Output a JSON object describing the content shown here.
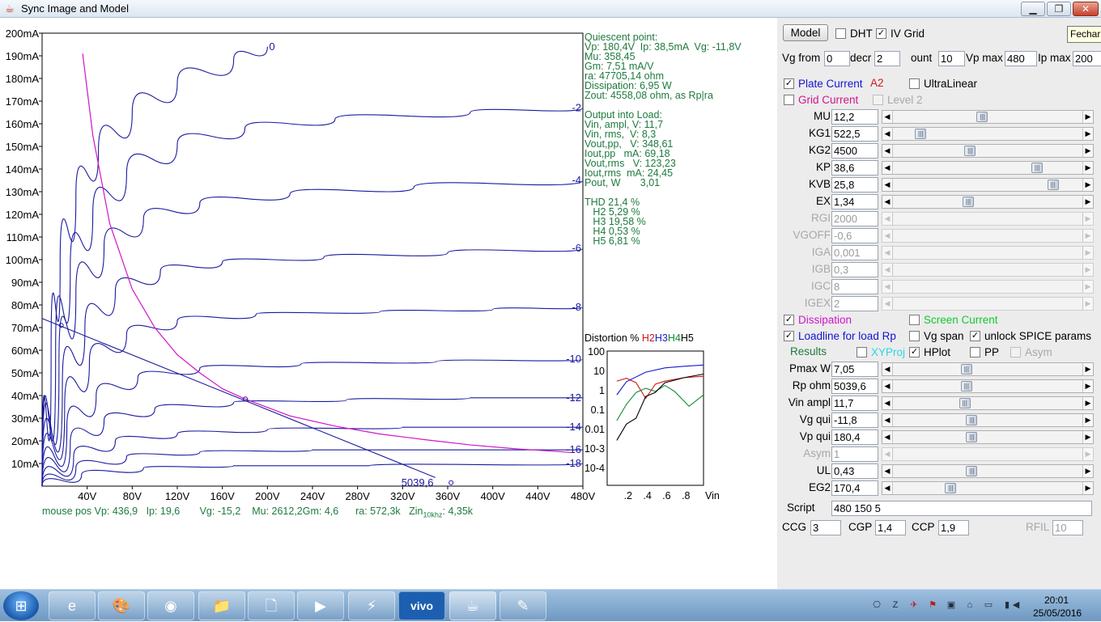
{
  "window": {
    "title": "Sync Image and Model",
    "min": "▁",
    "max": "❐",
    "close": "✕"
  },
  "chart_data": {
    "type": "line",
    "x": {
      "label": "Vp",
      "unit": "V",
      "min": 0,
      "max": 480,
      "ticks": [
        "40V",
        "80V",
        "120V",
        "160V",
        "200V",
        "240V",
        "280V",
        "320V",
        "360V",
        "400V",
        "440V",
        "480V"
      ]
    },
    "y": {
      "label": "Ip",
      "unit": "mA",
      "min": 0,
      "max": 200,
      "ticks": [
        "10mA",
        "20mA",
        "30mA",
        "40mA",
        "50mA",
        "60mA",
        "70mA",
        "80mA",
        "90mA",
        "100mA",
        "110mA",
        "120mA",
        "130mA",
        "140mA",
        "150mA",
        "160mA",
        "170mA",
        "180mA",
        "190mA",
        "200mA"
      ]
    },
    "grid": false,
    "curve_labels": [
      "0",
      "-2",
      "-4",
      "-6",
      "-8",
      "-10",
      "-12",
      "-14",
      "-16",
      "-18"
    ],
    "series": [
      {
        "vg": 0,
        "values": [
          [
            0,
            0
          ],
          [
            8,
            60
          ],
          [
            16,
            98
          ],
          [
            30,
            128
          ],
          [
            50,
            148
          ],
          [
            80,
            165
          ],
          [
            120,
            178
          ],
          [
            170,
            188
          ],
          [
            200,
            194
          ]
        ]
      },
      {
        "vg": -2,
        "values": [
          [
            0,
            0
          ],
          [
            12,
            60
          ],
          [
            25,
            96
          ],
          [
            45,
            120
          ],
          [
            75,
            138
          ],
          [
            120,
            151
          ],
          [
            180,
            158
          ],
          [
            260,
            162
          ],
          [
            380,
            165
          ],
          [
            480,
            167
          ]
        ]
      },
      {
        "vg": -4,
        "values": [
          [
            0,
            0
          ],
          [
            15,
            55
          ],
          [
            30,
            85
          ],
          [
            55,
            106
          ],
          [
            90,
            118
          ],
          [
            140,
            125
          ],
          [
            220,
            129
          ],
          [
            330,
            132
          ],
          [
            480,
            135
          ]
        ]
      },
      {
        "vg": -6,
        "values": [
          [
            0,
            0
          ],
          [
            18,
            45
          ],
          [
            38,
            70
          ],
          [
            65,
            86
          ],
          [
            105,
            95
          ],
          [
            160,
            99
          ],
          [
            250,
            101
          ],
          [
            360,
            103
          ],
          [
            480,
            105
          ]
        ]
      },
      {
        "vg": -8,
        "values": [
          [
            0,
            0
          ],
          [
            20,
            35
          ],
          [
            42,
            55
          ],
          [
            75,
            67
          ],
          [
            120,
            73
          ],
          [
            190,
            76
          ],
          [
            300,
            77
          ],
          [
            400,
            78
          ],
          [
            480,
            79
          ]
        ]
      },
      {
        "vg": -10,
        "values": [
          [
            0,
            0
          ],
          [
            22,
            26
          ],
          [
            48,
            40
          ],
          [
            85,
            48
          ],
          [
            140,
            52
          ],
          [
            230,
            54
          ],
          [
            350,
            55
          ],
          [
            480,
            56
          ]
        ]
      },
      {
        "vg": -12,
        "values": [
          [
            0,
            0
          ],
          [
            25,
            19
          ],
          [
            55,
            29
          ],
          [
            100,
            34
          ],
          [
            170,
            37
          ],
          [
            270,
            38
          ],
          [
            380,
            39
          ],
          [
            480,
            39
          ]
        ]
      },
      {
        "vg": -14,
        "values": [
          [
            0,
            0
          ],
          [
            28,
            13
          ],
          [
            65,
            20
          ],
          [
            120,
            23
          ],
          [
            200,
            25
          ],
          [
            320,
            26
          ],
          [
            480,
            26
          ]
        ]
      },
      {
        "vg": -16,
        "values": [
          [
            0,
            0
          ],
          [
            30,
            8
          ],
          [
            75,
            13
          ],
          [
            140,
            15
          ],
          [
            240,
            16
          ],
          [
            360,
            16
          ],
          [
            480,
            16
          ]
        ]
      },
      {
        "vg": -18,
        "values": [
          [
            0,
            0
          ],
          [
            35,
            5
          ],
          [
            90,
            8
          ],
          [
            170,
            9
          ],
          [
            290,
            9
          ],
          [
            480,
            10
          ]
        ]
      }
    ],
    "dissipation": [
      [
        36,
        191
      ],
      [
        45,
        155
      ],
      [
        60,
        116
      ],
      [
        80,
        87
      ],
      [
        100,
        70
      ],
      [
        120,
        58
      ],
      [
        140,
        50
      ],
      [
        160,
        43
      ],
      [
        180,
        38.5
      ],
      [
        220,
        31
      ],
      [
        260,
        26.5
      ],
      [
        300,
        23
      ],
      [
        340,
        20.5
      ],
      [
        380,
        18.2
      ],
      [
        420,
        16.5
      ],
      [
        460,
        15.2
      ],
      [
        470,
        14.8
      ]
    ],
    "loadline": [
      [
        0,
        74
      ],
      [
        349,
        3.8
      ]
    ],
    "q_point": [
      180.4,
      38.5
    ],
    "marker_low": [
      17,
      71
    ],
    "load_point_label": "5039,6",
    "load_point_marker": [
      363,
      1.5
    ]
  },
  "distortion_chart": {
    "y_ticks": [
      "100",
      "10",
      "1",
      "0.1",
      "0.01",
      "10-3",
      "10-4"
    ],
    "x_ticks": [
      ".2",
      ".4",
      ".6",
      ".8",
      "Vin"
    ],
    "series": [
      {
        "name": "H2",
        "color": "#d01818",
        "values": [
          [
            0.1,
            3.0
          ],
          [
            0.2,
            4.2
          ],
          [
            0.3,
            2.5
          ],
          [
            0.4,
            0.4
          ],
          [
            0.5,
            2.1
          ],
          [
            0.6,
            3.0
          ],
          [
            0.8,
            4.5
          ],
          [
            1.0,
            5.3
          ]
        ]
      },
      {
        "name": "H3",
        "color": "#1818d0",
        "values": [
          [
            0.1,
            0.6
          ],
          [
            0.2,
            2.8
          ],
          [
            0.4,
            8.5
          ],
          [
            0.6,
            14
          ],
          [
            0.8,
            17
          ],
          [
            1.0,
            19.6
          ]
        ]
      },
      {
        "name": "H4",
        "color": "#118a32",
        "values": [
          [
            0.1,
            0.03
          ],
          [
            0.2,
            0.2
          ],
          [
            0.3,
            0.8
          ],
          [
            0.4,
            1.3
          ],
          [
            0.5,
            0.9
          ],
          [
            0.6,
            1.8
          ],
          [
            0.7,
            0.9
          ],
          [
            0.85,
            0.16
          ],
          [
            1.0,
            0.6
          ]
        ]
      },
      {
        "name": "H5",
        "color": "#000000",
        "values": [
          [
            0.1,
            0.003
          ],
          [
            0.2,
            0.02
          ],
          [
            0.3,
            0.04
          ],
          [
            0.4,
            0.5
          ],
          [
            0.5,
            0.8
          ],
          [
            0.6,
            2.5
          ],
          [
            0.8,
            4.5
          ],
          [
            1.0,
            6.8
          ]
        ]
      }
    ]
  },
  "results": [
    "Quiescent point:",
    "Vp: 180,4V  Ip: 38,5mA  Vg: -11,8V",
    "Mu: 358,45",
    "Gm: 7,51 mA/V",
    "ra: 47705,14 ohm",
    "Dissipation: 6,95 W",
    "Zout: 4558,08 ohm, as Rp|ra",
    "",
    "Output into Load:",
    "Vin, ampl, V: 11,7",
    "Vin, rms,  V: 8,3",
    "Vout,pp,   V: 348,61",
    "Iout,pp   mA: 69,18",
    "Vout,rms   V: 123,23",
    "Iout,rms  mA: 24,45",
    "Pout, W       3,01",
    "",
    "THD 21,4 %",
    "   H2 5,29 %",
    "   H3 19,58 %",
    "   H4 0,53 %",
    "   H5 6,81 %"
  ],
  "distortion": {
    "prefix": "Distortion % ",
    "h2": "H2",
    "h3": "H3",
    "h4": "H4",
    "h5": "H5"
  },
  "mouse": {
    "vp": "mouse pos Vp: 436,9",
    "ip": "Ip: 19,6",
    "vg": "Vg: -15,2",
    "mu": "Mu: 2612,2",
    "gm": "Gm: 4,6",
    "ra": "ra: 572,3k",
    "zin": "Zin",
    "zin_sub": "10khz",
    "zin_val": ": 4,35k"
  },
  "panel": {
    "model_button": "Model",
    "dht": "DHT",
    "iv_grid": "IV Grid",
    "tooltip": "Fechar",
    "vg_from_label": "Vg from",
    "vg_from": "0",
    "decr_label": "decr",
    "decr": "2",
    "count_label": "ount",
    "count": "10",
    "vpmax_label": "Vp max",
    "vpmax": "480",
    "ipmax_label": "Ip max",
    "ipmax": "200",
    "plate_current": "Plate Current",
    "a2": "A2",
    "ultralinear": "UltraLinear",
    "grid_current": "Grid Current",
    "level2": "Level 2",
    "params": [
      {
        "label": "MU",
        "value": "12,2",
        "pos": 0.47,
        "enabled": true
      },
      {
        "label": "KG1",
        "value": "522,5",
        "pos": 0.12,
        "enabled": true
      },
      {
        "label": "KG2",
        "value": "4500",
        "pos": 0.4,
        "enabled": true
      },
      {
        "label": "KP",
        "value": "38,6",
        "pos": 0.78,
        "enabled": true
      },
      {
        "label": "KVB",
        "value": "25,8",
        "pos": 0.87,
        "enabled": true
      },
      {
        "label": "EX",
        "value": "1,34",
        "pos": 0.39,
        "enabled": true
      },
      {
        "label": "RGI",
        "value": "2000",
        "pos": null,
        "enabled": false
      },
      {
        "label": "VGOFF",
        "value": "-0,6",
        "pos": null,
        "enabled": false
      },
      {
        "label": "IGA",
        "value": "0,001",
        "pos": null,
        "enabled": false
      },
      {
        "label": "IGB",
        "value": "0,3",
        "pos": null,
        "enabled": false
      },
      {
        "label": "IGC",
        "value": "8",
        "pos": null,
        "enabled": false
      },
      {
        "label": "IGEX",
        "value": "2",
        "pos": null,
        "enabled": false
      }
    ],
    "dissipation": "Dissipation",
    "screen_current": "Screen Current",
    "loadline": "Loadline for load Rp",
    "vg_span": "Vg span",
    "unlock": "unlock SPICE params",
    "results_label": "Results",
    "xyproj": "XYProj",
    "hplot": "HPlot",
    "pp": "PP",
    "asym_chk": "Asym",
    "params2": [
      {
        "label": "Pmax W",
        "value": "7,05",
        "pos": 0.38,
        "enabled": true
      },
      {
        "label": "Rp ohm",
        "value": "5039,6",
        "pos": 0.38,
        "enabled": true
      },
      {
        "label": "Vin ampl",
        "value": "11,7",
        "pos": 0.37,
        "enabled": true
      },
      {
        "label": "Vg qui",
        "value": "-11,8",
        "pos": 0.41,
        "enabled": true
      },
      {
        "label": "Vp qui",
        "value": "180,4",
        "pos": 0.41,
        "enabled": true
      },
      {
        "label": "Asym",
        "value": "1",
        "pos": null,
        "enabled": false
      },
      {
        "label": "UL",
        "value": "0,43",
        "pos": 0.41,
        "enabled": true
      },
      {
        "label": "EG2",
        "value": "170,4",
        "pos": 0.29,
        "enabled": true
      }
    ],
    "script_label": "Script",
    "script_value": "480 150 5",
    "ccg_label": "CCG",
    "ccg": "3",
    "cgp_label": "CGP",
    "cgp": "1,4",
    "ccp_label": "CCP",
    "ccp": "1,9",
    "rfil_label": "RFIL",
    "rfil": "10"
  },
  "taskbar": {
    "start": "⊞",
    "apps": [
      {
        "name": "ie-icon",
        "glyph": "e"
      },
      {
        "name": "paint-icon",
        "glyph": "🎨"
      },
      {
        "name": "chrome-icon",
        "glyph": "◉"
      },
      {
        "name": "explorer-icon",
        "glyph": "📁"
      },
      {
        "name": "file-icon",
        "glyph": "🗋"
      },
      {
        "name": "media-player-icon",
        "glyph": "▶"
      },
      {
        "name": "winamp-icon",
        "glyph": "⚡"
      },
      {
        "name": "vivo-icon",
        "glyph": "vivo"
      },
      {
        "name": "java-icon",
        "glyph": "☕"
      },
      {
        "name": "notes-icon",
        "glyph": "✎"
      }
    ],
    "time": "20:01",
    "date": "25/05/2016"
  }
}
